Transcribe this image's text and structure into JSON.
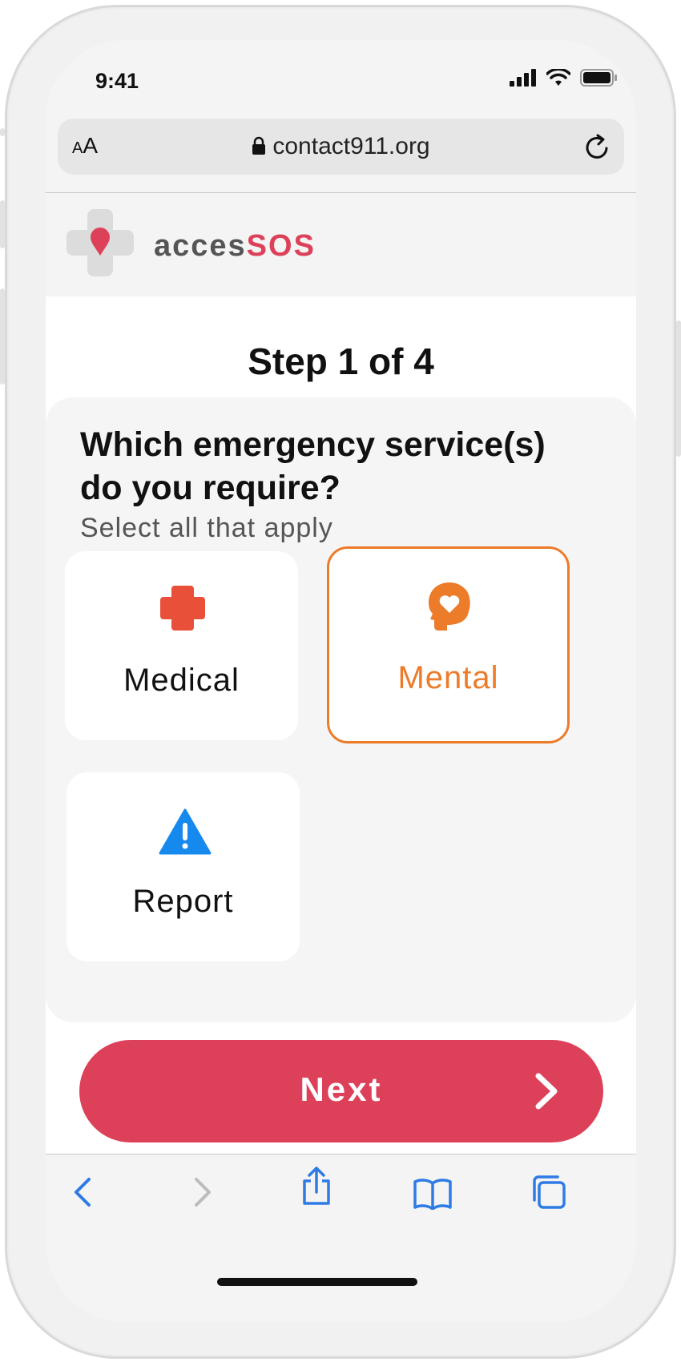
{
  "status_bar": {
    "time": "9:41"
  },
  "browser": {
    "text_size_small": "A",
    "text_size_large": "A",
    "url": "contact911.org"
  },
  "app": {
    "brand_part1": "acces",
    "brand_part2": "SOS"
  },
  "step": {
    "title": "Step 1 of 4"
  },
  "question": {
    "title": "Which emergency service(s) do you require?",
    "hint": "Select all that apply"
  },
  "options": [
    {
      "label": "Medical",
      "icon": "medical-cross-icon",
      "selected": false
    },
    {
      "label": "Mental",
      "icon": "mental-health-icon",
      "selected": true
    },
    {
      "label": "Report",
      "icon": "warning-icon",
      "selected": false
    }
  ],
  "next_button": {
    "label": "Next"
  },
  "toolbar": [
    "back",
    "forward",
    "share",
    "bookmarks",
    "tabs"
  ],
  "colors": {
    "brand_red": "#dd4159",
    "accent_orange": "#ec7b2a",
    "medical_red": "#e8503a",
    "report_blue": "#1589ee",
    "ios_blue": "#2f7be6"
  }
}
